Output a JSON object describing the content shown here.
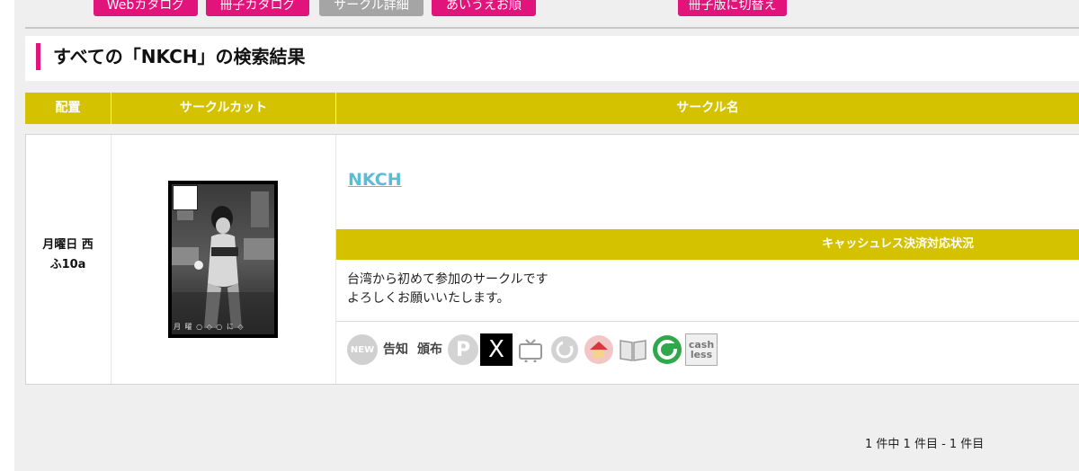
{
  "nav": {
    "buttons": [
      "Webカタログ",
      "冊子カタログ",
      "サークル詳細",
      "あいうえお順",
      "冊子版に切替え"
    ]
  },
  "page_title": "すべての「NKCH」の検索結果",
  "table": {
    "headers": [
      "配置",
      "サークルカット",
      "サークル名"
    ],
    "rows": [
      {
        "location_day": "月曜日 西",
        "location_booth": "ふ10a",
        "circle_name": "NKCH",
        "cashless_label": "キャッシュレス決済対応状況",
        "description": [
          "台湾から初めて参加のサークルです",
          "よろしくお願いいたします。"
        ],
        "cut_signature": "月 曜 ○ ◇ ○ に ◇",
        "icons": [
          {
            "name": "new-icon",
            "text": "NEW"
          },
          {
            "name": "notice-icon",
            "text": "告知"
          },
          {
            "name": "distribution-icon",
            "text": "頒布"
          },
          {
            "name": "pixiv-icon",
            "text": "P"
          },
          {
            "name": "x-twitter-icon",
            "text": "X"
          },
          {
            "name": "niconico-icon",
            "text": ""
          },
          {
            "name": "link-icon",
            "text": ""
          },
          {
            "name": "home-icon",
            "text": ""
          },
          {
            "name": "book-icon",
            "text": ""
          },
          {
            "name": "circle-ms-icon",
            "text": ""
          },
          {
            "name": "cashless-icon",
            "text": "cash less"
          }
        ]
      }
    ]
  },
  "pagination": "1 件中 1 件目 - 1 件目",
  "colors": {
    "accent": "#e0147a",
    "header": "#d4c200",
    "link": "#5bbcd6"
  }
}
